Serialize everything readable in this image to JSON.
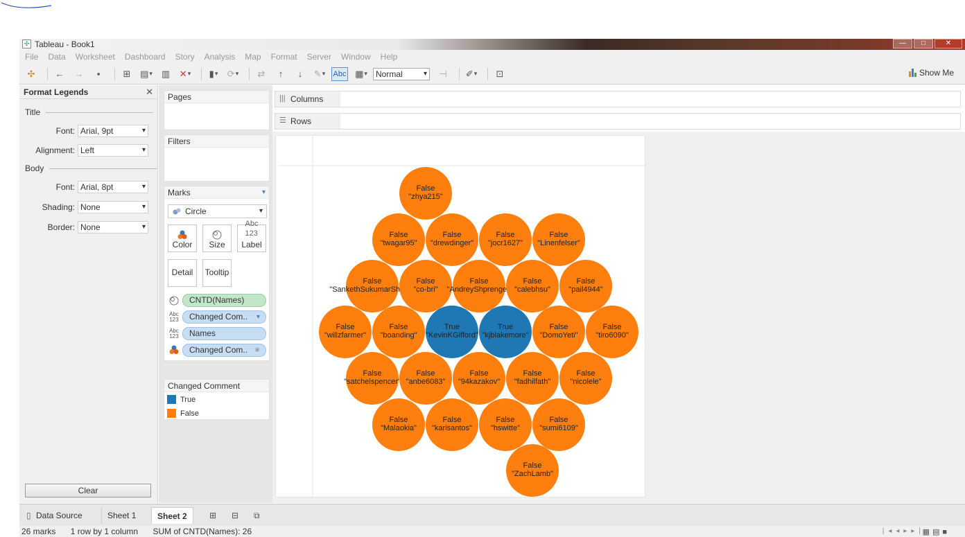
{
  "window": {
    "title": "Tableau - Book1",
    "buttons": [
      "—",
      "□",
      "✕"
    ]
  },
  "menu": [
    "File",
    "Data",
    "Worksheet",
    "Dashboard",
    "Story",
    "Analysis",
    "Map",
    "Format",
    "Server",
    "Window",
    "Help"
  ],
  "toolbar": {
    "fit_value": "Normal",
    "show_me": "Show Me",
    "abc": "Abc"
  },
  "format_panel": {
    "title": "Format Legends",
    "title_section": "Title",
    "body_section": "Body",
    "rows": {
      "title_font": {
        "label": "Font:",
        "value": "Arial, 9pt"
      },
      "alignment": {
        "label": "Alignment:",
        "value": "Left"
      },
      "body_font": {
        "label": "Font:",
        "value": "Arial, 8pt"
      },
      "shading": {
        "label": "Shading:",
        "value": "None"
      },
      "border": {
        "label": "Border:",
        "value": "None"
      }
    },
    "clear": "Clear"
  },
  "cards": {
    "pages": "Pages",
    "filters": "Filters",
    "marks": "Marks",
    "mark_type": "Circle",
    "buttons": {
      "color": "Color",
      "size": "Size",
      "label": "Label",
      "detail": "Detail",
      "tooltip": "Tooltip"
    },
    "pills": {
      "size_pill": "CNTD(Names)",
      "label_pill_1": "Changed Com..",
      "label_pill_2": "Names",
      "color_pill": "Changed Com.."
    },
    "legend": {
      "title": "Changed Comment",
      "items": [
        {
          "label": "True",
          "color": "#1f77b4"
        },
        {
          "label": "False",
          "color": "#ff7f0e"
        }
      ]
    }
  },
  "shelves": {
    "columns": "Columns",
    "rows": "Rows"
  },
  "chart_data": {
    "type": "scatter",
    "mark": "packed bubbles",
    "color_field": "Changed Comment",
    "colors": {
      "True": "#1f77b4",
      "False": "#ff7f0e"
    },
    "points": [
      {
        "changed": "False",
        "name": "\"zhya215\""
      },
      {
        "changed": "False",
        "name": "\"twagar95\""
      },
      {
        "changed": "False",
        "name": "\"drewdinger\""
      },
      {
        "changed": "False",
        "name": "\"jocr1627\""
      },
      {
        "changed": "False",
        "name": "\"Linenfelser\""
      },
      {
        "changed": "False",
        "name": "\"SankethSukumarShetty\""
      },
      {
        "changed": "False",
        "name": "\"co-bri\""
      },
      {
        "changed": "False",
        "name": "\"AndreyShprengel\""
      },
      {
        "changed": "False",
        "name": "\"calebhsu\""
      },
      {
        "changed": "False",
        "name": "\"pail4944\""
      },
      {
        "changed": "False",
        "name": "\"willzfarmer\""
      },
      {
        "changed": "False",
        "name": "\"boanding\""
      },
      {
        "changed": "True",
        "name": "\"KevinKGifford\""
      },
      {
        "changed": "True",
        "name": "\"kjblakemore\""
      },
      {
        "changed": "False",
        "name": "\"DomoYeti\""
      },
      {
        "changed": "False",
        "name": "\"tiro6090\""
      },
      {
        "changed": "False",
        "name": "\"satchelspencer\""
      },
      {
        "changed": "False",
        "name": "\"anbe6083\""
      },
      {
        "changed": "False",
        "name": "\"94kazakov\""
      },
      {
        "changed": "False",
        "name": "\"fadhilfath\""
      },
      {
        "changed": "False",
        "name": "\"nicolele\""
      },
      {
        "changed": "False",
        "name": "\"Malaokia\""
      },
      {
        "changed": "False",
        "name": "\"karisantos\""
      },
      {
        "changed": "False",
        "name": "\"hswitte\""
      },
      {
        "changed": "False",
        "name": "\"sumi6109\""
      },
      {
        "changed": "False",
        "name": "\"ZachLamb\""
      }
    ]
  },
  "tabs": {
    "data_source": "Data Source",
    "sheet1": "Sheet 1",
    "sheet2": "Sheet 2"
  },
  "status": {
    "marks": "26 marks",
    "grid": "1 row by 1 column",
    "sum": "SUM of CNTD(Names): 26"
  }
}
